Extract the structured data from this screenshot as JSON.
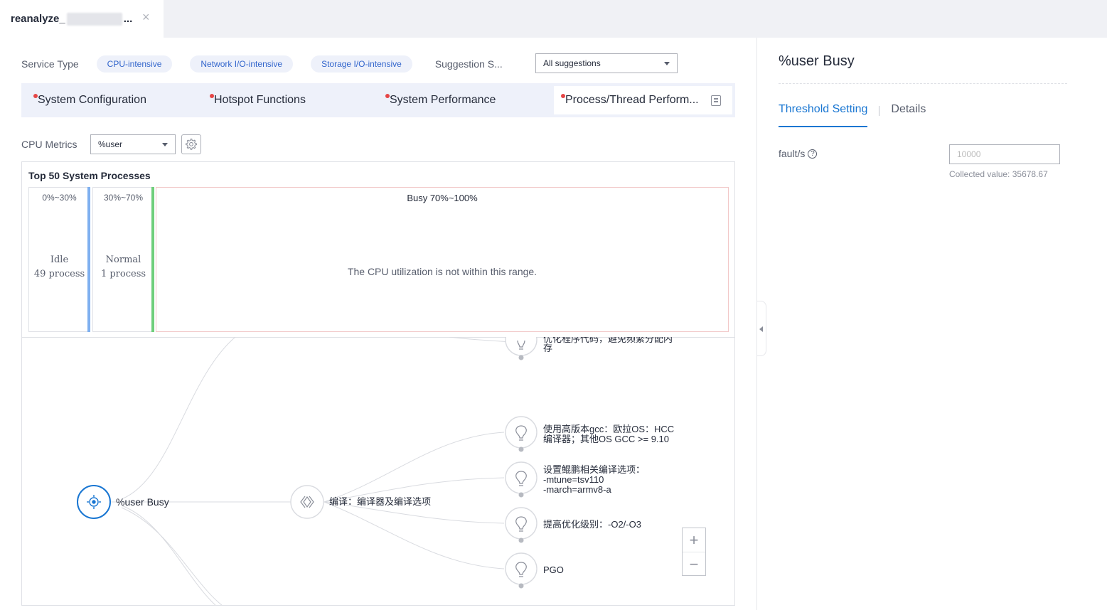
{
  "tab": {
    "title": "reanalyze_",
    "ellipsis": "...",
    "close": "×"
  },
  "service": {
    "label": "Service Type",
    "options": [
      "CPU-intensive",
      "Network I/O-intensive",
      "Storage I/O-intensive"
    ],
    "suggestion_label": "Suggestion S...",
    "suggestion_value": "All suggestions"
  },
  "categories": [
    "System Configuration",
    "Hotspot Functions",
    "System Performance",
    "Process/Thread Perform..."
  ],
  "cpu": {
    "label": "CPU Metrics",
    "value": "%user"
  },
  "processes": {
    "title": "Top 50 System Processes",
    "idle": {
      "range": "0%~30%",
      "name": "Idle",
      "count": "49 process"
    },
    "normal": {
      "range": "30%~70%",
      "name": "Normal",
      "count": "1 process"
    },
    "busy": {
      "range": "Busy 70%~100%",
      "message": "The CPU utilization is not within this range."
    }
  },
  "tree": {
    "root": "%user Busy",
    "compile": "编译：编译器及编译选项",
    "top_partial_line1": "优化程序代码，避免频繁分配内",
    "top_partial_line2": "存",
    "gcc_line1": "使用高版本gcc：欧拉OS：HCC",
    "gcc_line2": "编译器；其他OS GCC >= 9.10",
    "kunpeng_line1": "设置鲲鹏相关编译选项：",
    "kunpeng_line2": "-mtune=tsv110",
    "kunpeng_line3": "-march=armv8-a",
    "opt_level": "提高优化级别：-O2/-O3",
    "pgo": "PGO",
    "zoom_in": "+",
    "zoom_out": "−"
  },
  "right": {
    "title": "%user Busy",
    "tabs": [
      "Threshold Setting",
      "Details"
    ],
    "fault_label": "fault/s",
    "help": "?",
    "fault_placeholder": "10000",
    "collected": "Collected value: 35678.67"
  },
  "colors": {
    "accent": "#1976d2",
    "idle_bar": "#7fb0f0",
    "normal_bar": "#6fce7b",
    "red_dot": "#e54545"
  }
}
